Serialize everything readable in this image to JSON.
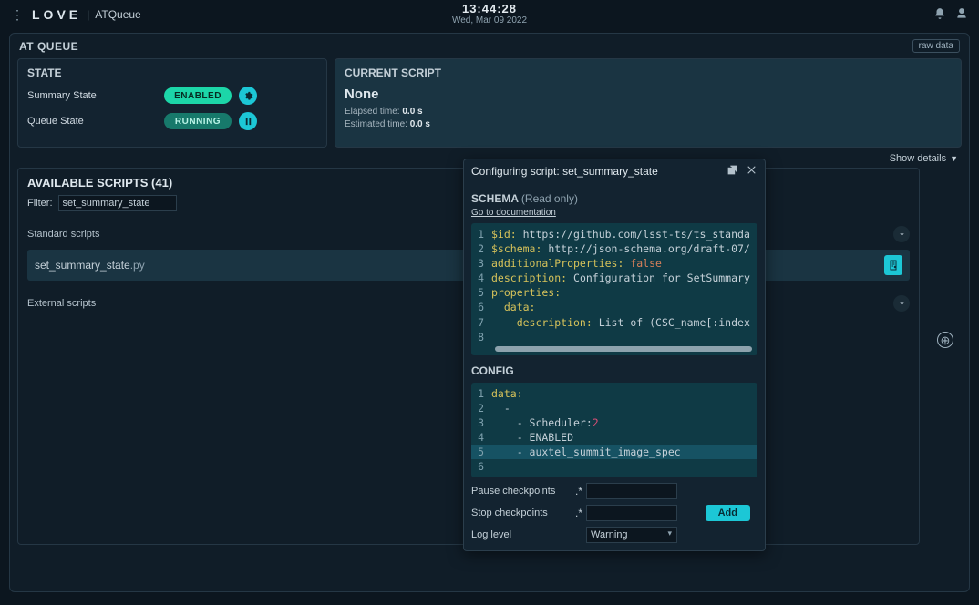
{
  "header": {
    "logo": "LOVE",
    "page": "ATQueue",
    "time": "13:44:28",
    "date": "Wed, Mar 09 2022"
  },
  "panel": {
    "title": "AT QUEUE",
    "raw_label": "raw data",
    "show_details": "Show details"
  },
  "state": {
    "heading": "STATE",
    "summary_label": "Summary State",
    "summary_value": "ENABLED",
    "queue_label": "Queue State",
    "queue_value": "RUNNING"
  },
  "current_script": {
    "heading": "CURRENT SCRIPT",
    "name": "None",
    "elapsed_label": "Elapsed time:",
    "elapsed_value": "0.0 s",
    "estimated_label": "Estimated time:",
    "estimated_value": "0.0 s"
  },
  "available": {
    "heading_prefix": "AVAILABLE SCRIPTS",
    "count": "(41)",
    "filter_label": "Filter:",
    "filter_value": "set_summary_state",
    "section_standard": "Standard scripts",
    "section_external": "External scripts",
    "item_name": "set_summary_state",
    "item_ext": ".py"
  },
  "modal": {
    "title_prefix": "Configuring script:",
    "title_name": "set_summary_state",
    "schema_label": "SCHEMA",
    "readonly": "(Read only)",
    "doc_link": "Go to documentation",
    "config_label": "CONFIG",
    "pause_label": "Pause checkpoints",
    "pause_suffix": ".*",
    "stop_label": "Stop checkpoints",
    "stop_suffix": ".*",
    "loglevel_label": "Log level",
    "loglevel_value": "Warning",
    "add_label": "Add"
  },
  "schema_code": {
    "l1": {
      "k": "$id:",
      "t": " https://github.com/lsst-ts/ts_standa"
    },
    "l2": {
      "k": "$schema:",
      "t": " http://json-schema.org/draft-07/"
    },
    "l3": {
      "k": "additionalProperties:",
      "b": " false"
    },
    "l4": {
      "k": "description:",
      "t": " Configuration for SetSummary"
    },
    "l5": {
      "k": "properties:"
    },
    "l6": {
      "k": "  data:"
    },
    "l7": {
      "k": "    description:",
      "t": " List of (CSC_name[:index"
    }
  },
  "config_code": {
    "l1": {
      "k": "data:"
    },
    "l2": {
      "t": "  -"
    },
    "l3a": "    - Scheduler:",
    "l3b": "2",
    "l4": {
      "t": "    - ENABLED"
    },
    "l5": {
      "t": "    - auxtel_summit_image_spec"
    }
  }
}
